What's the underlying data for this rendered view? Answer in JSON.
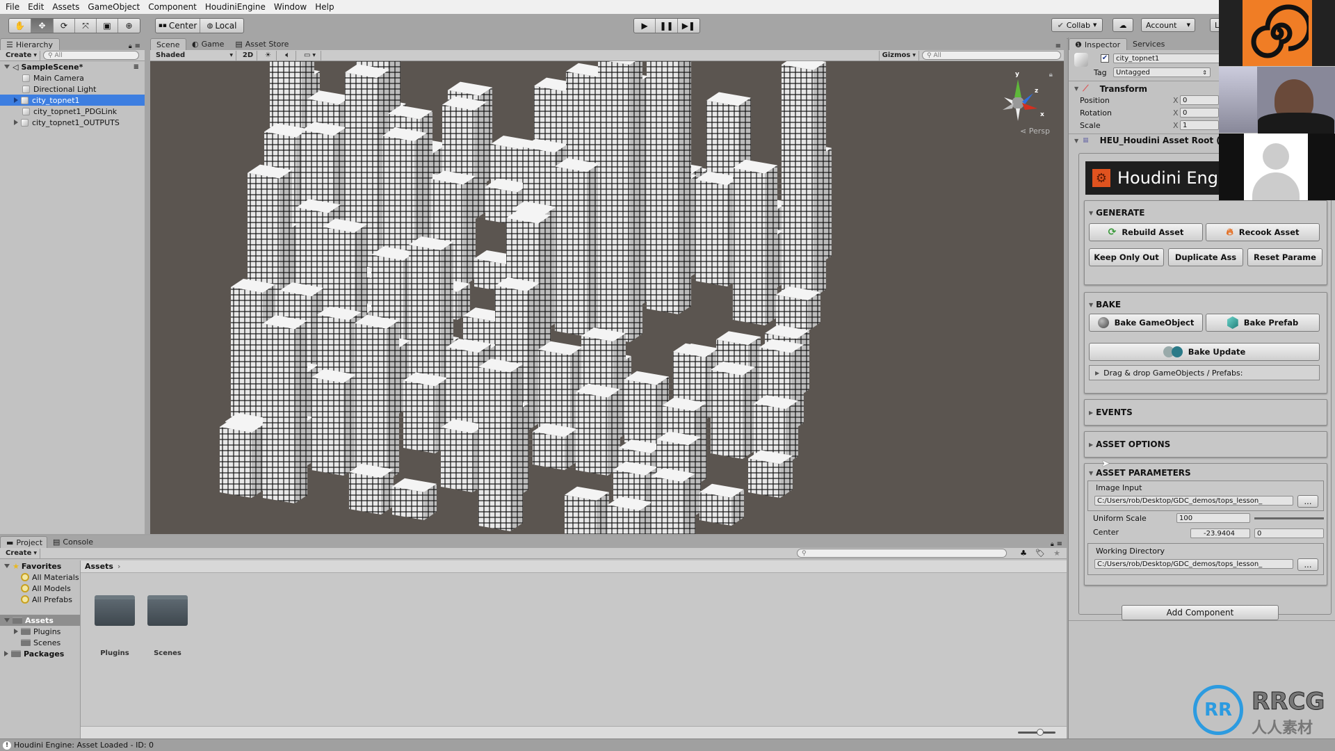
{
  "menu": [
    "File",
    "Edit",
    "Assets",
    "GameObject",
    "Component",
    "HoudiniEngine",
    "Window",
    "Help"
  ],
  "toolbar": {
    "tools": [
      "hand-tool",
      "move-tool",
      "rotate-tool",
      "scale-tool",
      "rect-tool",
      "transform-tool"
    ],
    "pivot_center": "Center",
    "pivot_local": "Local",
    "collab": "Collab",
    "account": "Account",
    "layers_partial": "L"
  },
  "hierarchy": {
    "tab": "Hierarchy",
    "create": "Create",
    "search_placeholder": "All",
    "scene": "SampleScene*",
    "items": [
      {
        "label": "Main Camera",
        "selected": false,
        "expandable": false
      },
      {
        "label": "Directional Light",
        "selected": false,
        "expandable": false
      },
      {
        "label": "city_topnet1",
        "selected": true,
        "expandable": true
      },
      {
        "label": "city_topnet1_PDGLink",
        "selected": false,
        "expandable": false
      },
      {
        "label": "city_topnet1_OUTPUTS",
        "selected": false,
        "expandable": true
      }
    ]
  },
  "scene": {
    "tabs": [
      "Scene",
      "Game",
      "Asset Store"
    ],
    "shading": "Shaded",
    "mode_2d": "2D",
    "gizmos": "Gizmos",
    "search_placeholder": "All",
    "persp": "Persp",
    "axes": {
      "y": "y",
      "z": "z",
      "x": "x"
    }
  },
  "project": {
    "tabs": [
      "Project",
      "Console"
    ],
    "create": "Create",
    "favorites_label": "Favorites",
    "favorites": [
      "All Materials",
      "All Models",
      "All Prefabs"
    ],
    "assets_label": "Assets",
    "assets_children": [
      "Plugins",
      "Scenes"
    ],
    "packages_label": "Packages",
    "breadcrumb": "Assets",
    "folders": [
      "Plugins",
      "Scenes"
    ]
  },
  "status": {
    "message": "Houdini Engine: Asset Loaded - ID: 0",
    "zoom_slider_fraction": 0.6
  },
  "inspector": {
    "tabs": [
      "Inspector",
      "Services"
    ],
    "object_name": "city_topnet1",
    "active": true,
    "tag_label": "Tag",
    "tag_value": "Untagged",
    "transform": {
      "title": "Transform",
      "rows": [
        {
          "label": "Position",
          "axis": "X",
          "value": "0"
        },
        {
          "label": "Rotation",
          "axis": "X",
          "value": "0"
        },
        {
          "label": "Scale",
          "axis": "X",
          "value": "1"
        }
      ]
    },
    "component_title": "HEU_Houdini Asset Root (",
    "banner": "Houdini Engi",
    "generate": {
      "title": "GENERATE",
      "rebuild": "Rebuild Asset",
      "recook": "Recook Asset",
      "keep_only": "Keep Only Out",
      "duplicate": "Duplicate Ass",
      "reset": "Reset Parame"
    },
    "bake": {
      "title": "BAKE",
      "bake_gameobject": "Bake GameObject",
      "bake_prefab": "Bake Prefab",
      "bake_update": "Bake Update",
      "dragdrop": "Drag & drop GameObjects / Prefabs:"
    },
    "events": "EVENTS",
    "asset_options": "ASSET OPTIONS",
    "asset_parameters": {
      "title": "ASSET PARAMETERS",
      "image_input_label": "Image Input",
      "image_input_value": "C:/Users/rob/Desktop/GDC_demos/tops_lesson_",
      "browse": "...",
      "uniform_scale_label": "Uniform Scale",
      "uniform_scale_value": "100",
      "center_label": "Center",
      "center_x": "-23.9404",
      "center_y": "0",
      "working_dir_label": "Working Directory",
      "working_dir_value": "C:/Users/rob/Desktop/GDC_demos/tops_lesson_"
    },
    "add_component": "Add Component"
  },
  "watermark": {
    "brand": "RRCG",
    "brand_cn": "人人素材"
  },
  "colors": {
    "selection": "#3d7ee0",
    "houdini_orange": "#e0531f",
    "viewport_bg": "#5b5550",
    "panel": "#c2c2c2"
  }
}
